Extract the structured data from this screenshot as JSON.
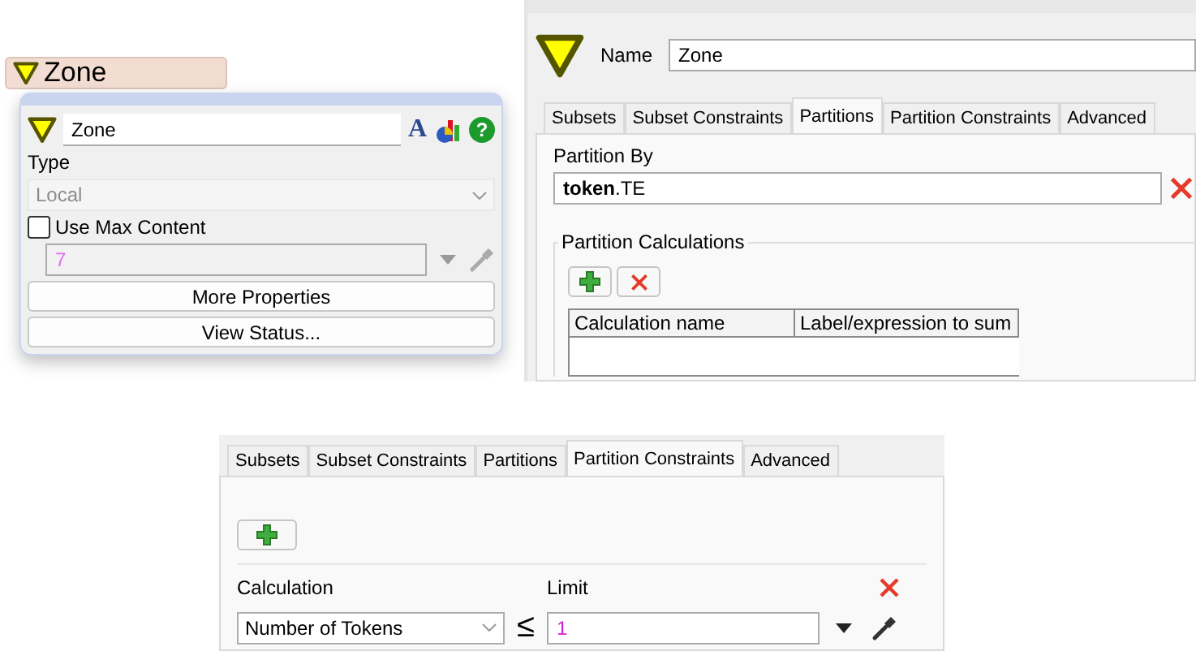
{
  "canvas_node": {
    "label": "Zone"
  },
  "quick_panel": {
    "name": "Zone",
    "font_glyph": "A",
    "help_glyph": "?",
    "type_label": "Type",
    "type_value": "Local",
    "type_disabled": true,
    "max_content": {
      "label": "Use Max Content",
      "checked": false,
      "value": "7"
    },
    "buttons": [
      "More Properties",
      "View Status..."
    ]
  },
  "properties_dialog": {
    "name_label": "Name",
    "name_value": "Zone",
    "tabs": [
      {
        "label": "Subsets",
        "selected": false
      },
      {
        "label": "Subset Constraints",
        "selected": false
      },
      {
        "label": "Partitions",
        "selected": true
      },
      {
        "label": "Partition Constraints",
        "selected": false
      },
      {
        "label": "Advanced",
        "selected": false
      }
    ],
    "partition_by_label": "Partition By",
    "partition_by_value": "**token**.TE",
    "group_title": "Partition Calculations",
    "table": {
      "columns": [
        "Calculation name",
        "Label/expression to sum"
      ]
    }
  },
  "constraints_dialog": {
    "tabs": [
      {
        "label": "Subsets",
        "selected": false
      },
      {
        "label": "Subset Constraints",
        "selected": false
      },
      {
        "label": "Partitions",
        "selected": false
      },
      {
        "label": "Partition Constraints",
        "selected": true
      },
      {
        "label": "Advanced",
        "selected": false
      }
    ],
    "calculation_label": "Calculation",
    "calculation_value": "Number of Tokens",
    "operator": "≤",
    "limit_label": "Limit",
    "limit_value": "1"
  }
}
